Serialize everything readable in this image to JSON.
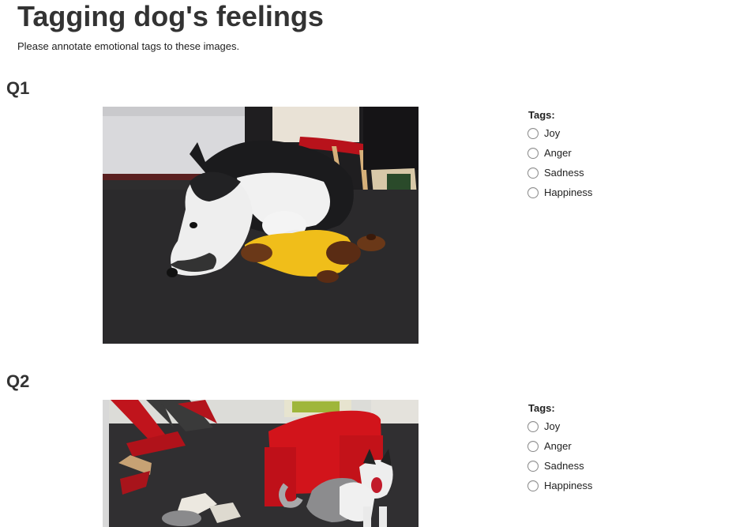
{
  "header": {
    "title": "Tagging dog's feelings",
    "instructions": "Please annotate emotional tags to these images."
  },
  "questions": [
    {
      "label": "Q1",
      "tags_title": "Tags:",
      "options": [
        "Joy",
        "Anger",
        "Sadness",
        "Happiness"
      ]
    },
    {
      "label": "Q2",
      "tags_title": "Tags:",
      "options": [
        "Joy",
        "Anger",
        "Sadness",
        "Happiness"
      ]
    }
  ]
}
